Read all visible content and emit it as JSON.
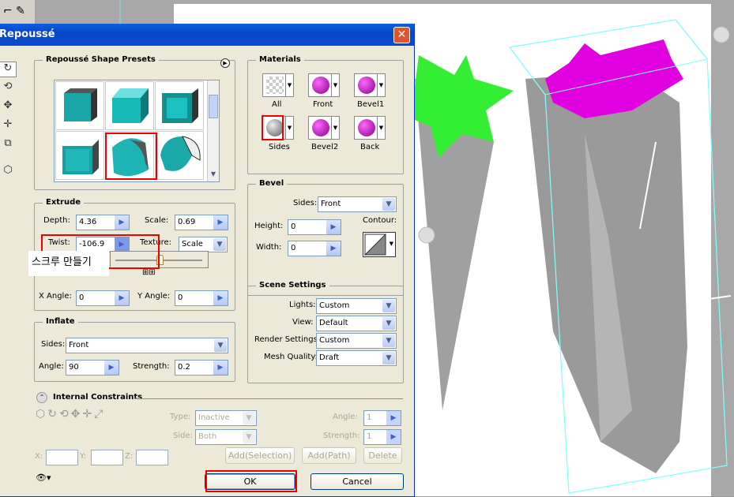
{
  "dialog": {
    "title": "Repoussé",
    "close_icon": "close-icon"
  },
  "presets": {
    "title": "Repoussé Shape Presets",
    "count": 6,
    "selected_index": 4
  },
  "materials": {
    "title": "Materials",
    "items": [
      {
        "label": "All",
        "color": "#dddddd"
      },
      {
        "label": "Front",
        "color": "#c000c0"
      },
      {
        "label": "Bevel1",
        "color": "#c000c0"
      },
      {
        "label": "Sides",
        "color": "#8a8a8a"
      },
      {
        "label": "Bevel2",
        "color": "#c000c0"
      },
      {
        "label": "Back",
        "color": "#c000c0"
      }
    ]
  },
  "extrude": {
    "title": "Extrude",
    "depth_label": "Depth:",
    "depth": "4.36",
    "scale_label": "Scale:",
    "scale": "0.69",
    "twist_label": "Twist:",
    "twist": "-106.9",
    "texture_label": "Texture:",
    "texture": "Scale",
    "tooltip": "스크루 만들기",
    "xangle_label": "X Angle:",
    "xangle": "0",
    "yangle_label": "Y Angle:",
    "yangle": "0"
  },
  "bevel": {
    "title": "Bevel",
    "sides_label": "Sides:",
    "sides": "Front",
    "height_label": "Height:",
    "height": "0",
    "width_label": "Width:",
    "width": "0",
    "contour_label": "Contour:"
  },
  "inflate": {
    "title": "Inflate",
    "sides_label": "Sides:",
    "sides": "Front",
    "angle_label": "Angle:",
    "angle": "90",
    "strength_label": "Strength:",
    "strength": "0.2"
  },
  "scene": {
    "title": "Scene Settings",
    "lights_label": "Lights:",
    "lights": "Custom",
    "view_label": "View:",
    "view": "Default",
    "render_label": "Render Settings:",
    "render": "Custom",
    "mesh_label": "Mesh Quality:",
    "mesh": "Draft"
  },
  "constraints": {
    "title": "Internal Constraints",
    "type_label": "Type:",
    "type": "Inactive",
    "side_label": "Side:",
    "side": "Both",
    "angle_label": "Angle:",
    "angle": "1",
    "strength_label": "Strength:",
    "strength": "1",
    "x_label": "X:",
    "y_label": "Y:",
    "z_label": "Z:",
    "add_selection": "Add(Selection)",
    "add_path": "Add(Path)",
    "delete": "Delete"
  },
  "buttons": {
    "ok": "OK",
    "cancel": "Cancel"
  },
  "colors": {
    "highlight": "#e00000",
    "front": "#e000e0",
    "star_green": "#33ee33",
    "sides": "#9a9a9a"
  }
}
